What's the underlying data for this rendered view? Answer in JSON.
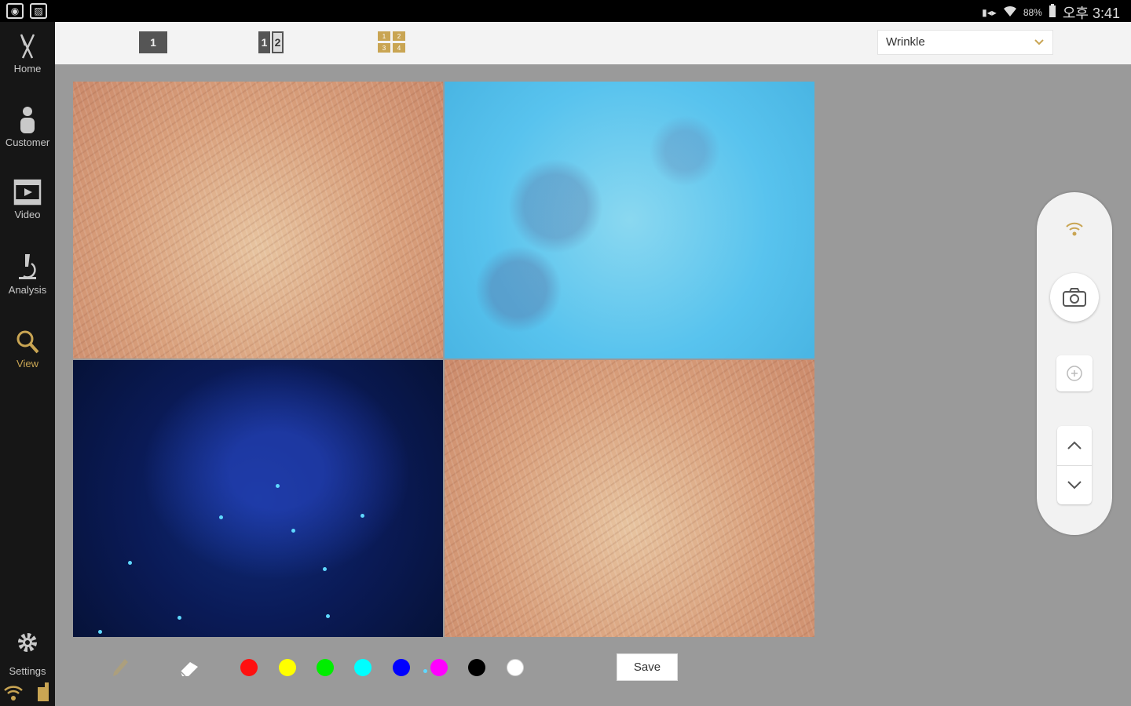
{
  "status_bar": {
    "battery": "88%",
    "time": "오후 3:41",
    "left_icons": [
      "camera-app-icon",
      "gallery-icon"
    ],
    "right_icons": [
      "vibrate-icon",
      "wifi-icon",
      "battery-icon"
    ]
  },
  "sidebar": {
    "items": [
      {
        "label": "Home",
        "icon": "tweezers-icon",
        "active": false
      },
      {
        "label": "Customer",
        "icon": "person-icon",
        "active": false
      },
      {
        "label": "Video",
        "icon": "film-icon",
        "active": false
      },
      {
        "label": "Analysis",
        "icon": "microscope-icon",
        "active": false
      },
      {
        "label": "View",
        "icon": "magnifier-icon",
        "active": true
      }
    ],
    "settings_label": "Settings"
  },
  "toolbar": {
    "layout_single": "1",
    "layout_double": [
      "1",
      "2"
    ],
    "layout_quad": [
      "1",
      "2",
      "3",
      "4"
    ],
    "mode_select_value": "Wrinkle"
  },
  "images": [
    {
      "position": "top-left",
      "type": "normal-light skin"
    },
    {
      "position": "top-right",
      "type": "polarized-blue skin"
    },
    {
      "position": "bottom-left",
      "type": "UV fluorescence"
    },
    {
      "position": "bottom-right",
      "type": "normal-light skin"
    }
  ],
  "draw_tools": {
    "pen_icon": "pencil-icon",
    "eraser_icon": "eraser-icon",
    "colors": [
      "#ff1010",
      "#ffff00",
      "#00ee00",
      "#00ffff",
      "#0000ff",
      "#ff00ff",
      "#000000",
      "#ffffff"
    ],
    "save_label": "Save"
  },
  "capture_panel": {
    "icons": [
      "wifi-signal-icon",
      "camera-icon",
      "focus-icon",
      "chevron-up-icon",
      "chevron-down-icon"
    ]
  },
  "colors": {
    "accent": "#c9a553",
    "sidebar_bg": "#161616",
    "workspace_bg": "#9a9a9a"
  }
}
